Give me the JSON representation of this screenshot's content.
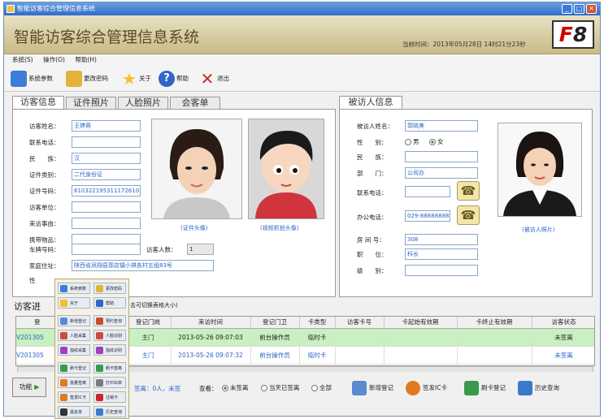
{
  "window": {
    "title": "智能访客综合管理信息系统"
  },
  "banner": {
    "title": "智能访客综合管理信息系统",
    "time": "当前时间：2013年05月28日 14时21分23秒",
    "hotkey_f": "F",
    "hotkey_num": "8"
  },
  "menu": [
    "系统(S)",
    "操作(O)",
    "帮助(H)"
  ],
  "toolbar": [
    {
      "label": "系统参数",
      "icon": "system-settings-icon",
      "color": "#3b7dd8"
    },
    {
      "label": "更改密码",
      "icon": "key-icon",
      "color": "#e2b43c"
    },
    {
      "label": "关于",
      "icon": "star-icon",
      "color": "#f2c22a"
    },
    {
      "label": "帮助",
      "icon": "help-icon",
      "color": "#2f66c8"
    },
    {
      "label": "退出",
      "icon": "exit-icon",
      "color": "#d02828"
    }
  ],
  "tabs": [
    "访客信息",
    "证件照片",
    "人脸照片",
    "会客单"
  ],
  "visitor": {
    "name_label": "访客姓名：",
    "name": "王婷蓉",
    "phone_label": "联系电话：",
    "phone": "",
    "ethnic_label": "民　　族：",
    "ethnic": "汉",
    "idtype_label": "证件类别：",
    "idtype": "二代身份证",
    "idno_label": "证件号码：",
    "idno": "610322195311172610",
    "unit_label": "访客单位：",
    "unit": "",
    "reason_label": "来访事由：",
    "reason": "",
    "items_label": "携带物品：",
    "items": "",
    "plate_label": "车牌号码：",
    "plate": "",
    "count_label": "访客人数：",
    "count": "1",
    "address_label": "家庭住址：",
    "address": "陕西省凤翔县郭店镇小祺各村五组83号",
    "gender_label": "性",
    "photo_id_caption": "(证件头像)",
    "photo_cam_caption": "(视频抓拍头像)"
  },
  "host": {
    "tab": "被访人信息",
    "name_label": "被访人姓名：",
    "name": "郭晓美",
    "gender_label": "性　　别：",
    "gender_male": "男",
    "gender_female": "女",
    "ethnic_label": "民　　族：",
    "ethnic": "",
    "dept_label": "部　　门：",
    "dept": "公司办",
    "phone_label": "联系电话：",
    "phone": "",
    "office_label": "办公电话：",
    "office": "029-88888888",
    "room_label": "房 间 号：",
    "room": "308",
    "title_label": "职　　位：",
    "title": "科长",
    "level_label": "级　　别：",
    "level": "",
    "photo_caption": "(被访人照片)"
  },
  "list": {
    "title": "访客进",
    "hint": "击可切换表格大小)",
    "columns": [
      "登",
      "",
      "登记门岗",
      "来访时间",
      "登记门卫",
      "卡类型",
      "访客卡号",
      "卡起始有效期",
      "卡终止有效期",
      "访客状态"
    ],
    "rows": [
      {
        "id": "V201305",
        "gate": "主门",
        "time": "2013-05-26 09:07:03",
        "guard": "前台操作员",
        "card": "临时卡",
        "status": "未签离"
      },
      {
        "id": "V201305",
        "gate": "主门",
        "time": "2013-05-26 09:07:32",
        "guard": "前台操作员",
        "card": "临时卡",
        "status": "未签离"
      }
    ]
  },
  "bottom": {
    "func": "功能",
    "stat": "签离：0人，未签",
    "view_label": "查看：",
    "opt1": "未签离",
    "opt2": "当天已签离",
    "opt3": "全部",
    "buttons": [
      {
        "label": "新增登记",
        "icon": "add-register-icon",
        "color": "#5a8ad0"
      },
      {
        "label": "签发IC卡",
        "icon": "ic-card-icon",
        "color": "#e07a20"
      },
      {
        "label": "刷卡登记",
        "icon": "card-swipe-icon",
        "color": "#3a9a4a"
      },
      {
        "label": "历史查询",
        "icon": "history-icon",
        "color": "#3a7ac8"
      }
    ]
  },
  "popup": [
    {
      "label": "系统参数",
      "color": "#3b7dd8"
    },
    {
      "label": "更改密码",
      "color": "#e2b43c"
    },
    {
      "label": "关于",
      "color": "#f2c22a"
    },
    {
      "label": "帮助",
      "color": "#2f66c8"
    },
    {
      "label": "新增登记",
      "color": "#5a8ad0"
    },
    {
      "label": "预约查询",
      "color": "#c84a2a"
    },
    {
      "label": "人脸采集",
      "color": "#d04a3a"
    },
    {
      "label": "人脸识别",
      "color": "#d04a3a"
    },
    {
      "label": "指纹采集",
      "color": "#a040c0"
    },
    {
      "label": "指纹识别",
      "color": "#a040c0"
    },
    {
      "label": "刷卡登记",
      "color": "#3a9a4a"
    },
    {
      "label": "刷卡签离",
      "color": "#3a9a4a"
    },
    {
      "label": "批量签离",
      "color": "#e07a20"
    },
    {
      "label": "打印出单",
      "color": "#7a7a7a"
    },
    {
      "label": "签发IC卡",
      "color": "#e07a20"
    },
    {
      "label": "注销卡",
      "color": "#c82828"
    },
    {
      "label": "黑名单",
      "color": "#333"
    },
    {
      "label": "历史查询",
      "color": "#3a7ac8"
    }
  ]
}
